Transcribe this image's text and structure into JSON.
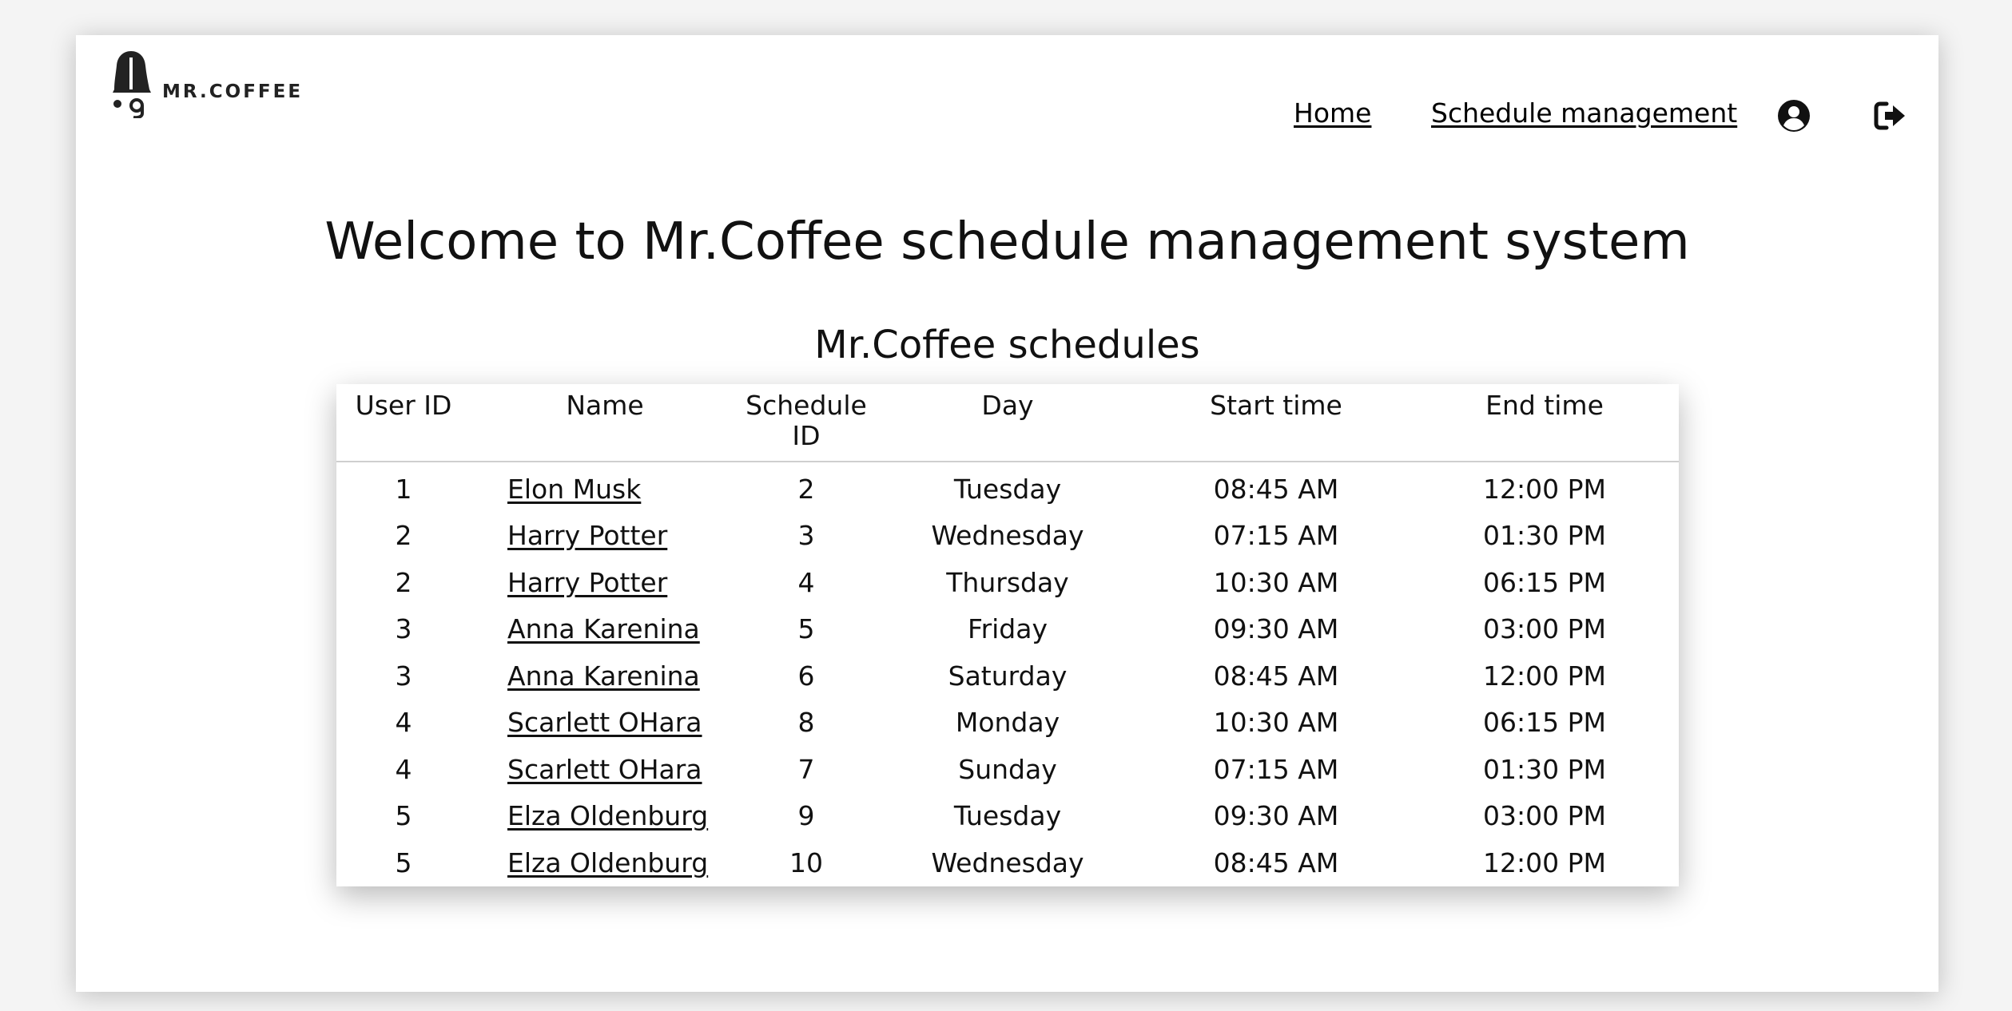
{
  "brand": {
    "logo_text": "MR.COFFEE"
  },
  "nav": {
    "home_label": "Home",
    "schedule_label": "Schedule management",
    "user_icon": "user-circle-icon",
    "logout_icon": "sign-out-icon"
  },
  "main": {
    "title": "Welcome to Mr.Coffee schedule management system",
    "section_title": "Mr.Coffee schedules"
  },
  "table": {
    "headers": {
      "user_id": "User ID",
      "name": "Name",
      "schedule_id_line1": "Schedule",
      "schedule_id_line2": "ID",
      "day": "Day",
      "start_time": "Start time",
      "end_time": "End time"
    },
    "rows": [
      {
        "user_id": "1",
        "name": "Elon Musk",
        "schedule_id": "2",
        "day": "Tuesday",
        "start": "08:45 AM",
        "end": "12:00 PM"
      },
      {
        "user_id": "2",
        "name": "Harry Potter",
        "schedule_id": "3",
        "day": "Wednesday",
        "start": "07:15 AM",
        "end": "01:30 PM"
      },
      {
        "user_id": "2",
        "name": "Harry Potter",
        "schedule_id": "4",
        "day": "Thursday",
        "start": "10:30 AM",
        "end": "06:15 PM"
      },
      {
        "user_id": "3",
        "name": "Anna Karenina",
        "schedule_id": "5",
        "day": "Friday",
        "start": "09:30 AM",
        "end": "03:00 PM"
      },
      {
        "user_id": "3",
        "name": "Anna Karenina",
        "schedule_id": "6",
        "day": "Saturday",
        "start": "08:45 AM",
        "end": "12:00 PM"
      },
      {
        "user_id": "4",
        "name": "Scarlett OHara",
        "schedule_id": "8",
        "day": "Monday",
        "start": "10:30 AM",
        "end": "06:15 PM"
      },
      {
        "user_id": "4",
        "name": "Scarlett OHara",
        "schedule_id": "7",
        "day": "Sunday",
        "start": "07:15 AM",
        "end": "01:30 PM"
      },
      {
        "user_id": "5",
        "name": "Elza Oldenburg",
        "schedule_id": "9",
        "day": "Tuesday",
        "start": "09:30 AM",
        "end": "03:00 PM"
      },
      {
        "user_id": "5",
        "name": "Elza Oldenburg",
        "schedule_id": "10",
        "day": "Wednesday",
        "start": "08:45 AM",
        "end": "12:00 PM"
      }
    ]
  }
}
